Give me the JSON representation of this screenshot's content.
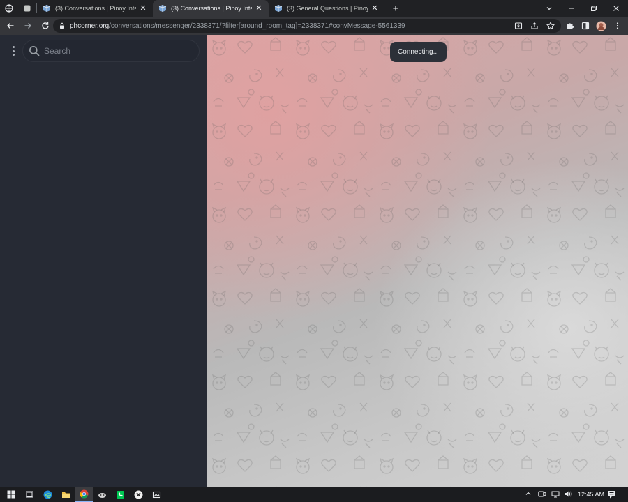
{
  "browser": {
    "tabs": [
      {
        "title": "(3) Conversations | Pinoy Internet",
        "active": false
      },
      {
        "title": "(3) Conversations | Pinoy Internet",
        "active": true
      },
      {
        "title": "(3) General Questions | Pinoy Inte",
        "active": false
      }
    ],
    "url": {
      "host": "phcorner.org",
      "path": "/conversations/messenger/2338371/?filter[around_room_tag]=2338371#convMessage-5561339"
    }
  },
  "sidebar": {
    "search_placeholder": "Search"
  },
  "chat": {
    "status": "Connecting..."
  },
  "taskbar": {
    "time": "12:45 AM"
  },
  "colors": {
    "sidebar_bg": "#262a34",
    "chat_bg_pink": "#d9a6a6",
    "chat_bg_gray": "#c9c9c9",
    "status_pill": "#2c3038"
  }
}
